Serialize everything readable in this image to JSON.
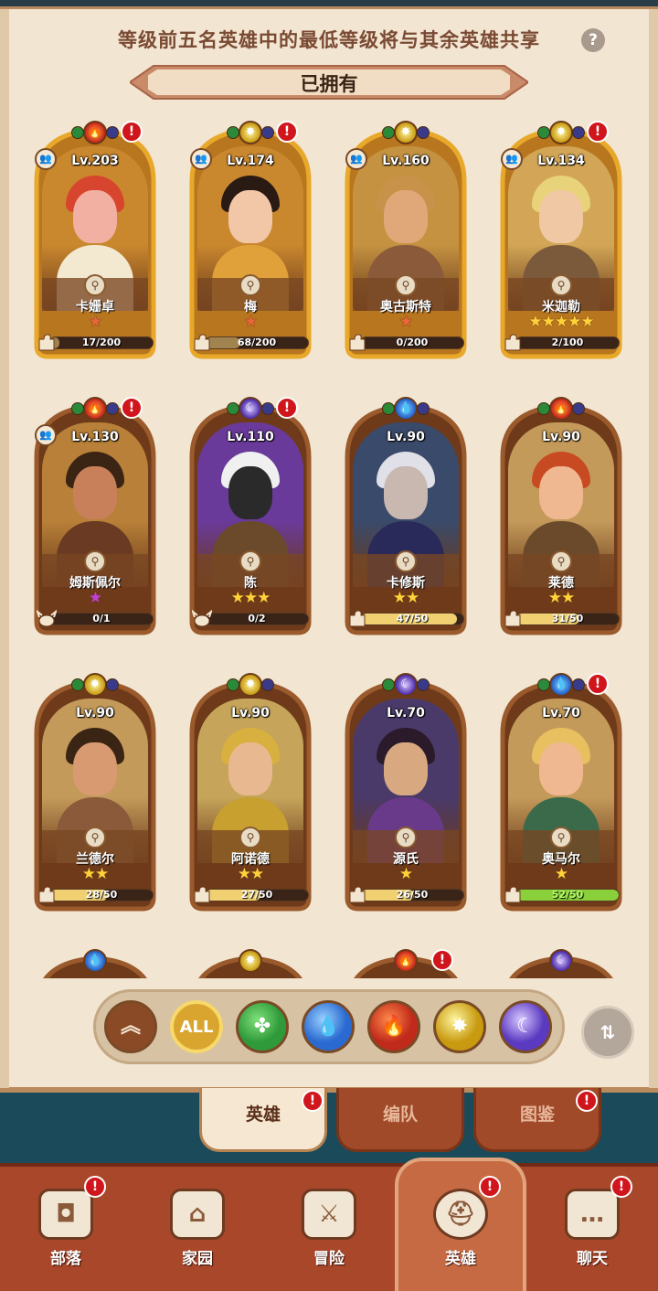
{
  "info_text": "等级前五名英雄中的最低等级将与其余英雄共享",
  "help_icon": "?",
  "section_title": "已拥有",
  "heroes": [
    {
      "level": "Lv.203",
      "name": "卡姗卓",
      "stars": "★",
      "star_color": "#e8663a",
      "progress_text": "17/200",
      "progress": 0.085,
      "fill_color": "#a1834f",
      "shard": "puzzle",
      "frame": "gold",
      "bg": "#c9872e",
      "hair": "#d8452e",
      "skin": "#f1b0a2",
      "outfit": "#f3e8d0",
      "elements": [
        "fire"
      ],
      "alert": true,
      "people": true
    },
    {
      "level": "Lv.174",
      "name": "梅",
      "stars": "★",
      "star_color": "#e8663a",
      "progress_text": "68/200",
      "progress": 0.34,
      "fill_color": "#a1834f",
      "shard": "puzzle",
      "frame": "gold",
      "bg": "#c9872e",
      "hair": "#2a1a14",
      "skin": "#f2c7a8",
      "outfit": "#e0a13a",
      "elements": [
        "light"
      ],
      "alert": true,
      "people": true
    },
    {
      "level": "Lv.160",
      "name": "奥古斯特",
      "stars": "★",
      "star_color": "#e8663a",
      "progress_text": "0/200",
      "progress": 0.0,
      "fill_color": "#a1834f",
      "shard": "puzzle",
      "frame": "gold",
      "bg": "#c49240",
      "hair": "#c8924a",
      "skin": "#e0a878",
      "outfit": "#8a5a3a",
      "elements": [
        "light"
      ],
      "alert": false,
      "people": true
    },
    {
      "level": "Lv.134",
      "name": "米迦勒",
      "stars": "★★★★★",
      "star_color": "#ffd23a",
      "progress_text": "2/100",
      "progress": 0.02,
      "fill_color": "#a1834f",
      "shard": "puzzle",
      "frame": "gold",
      "bg": "#d2a656",
      "hair": "#e8d27a",
      "skin": "#f0c8a4",
      "outfit": "#7a5a3a",
      "elements": [
        "light"
      ],
      "alert": true,
      "people": true
    },
    {
      "level": "Lv.130",
      "name": "姆斯佩尔",
      "stars": "★",
      "star_color": "#c040d8",
      "progress_text": "0/1",
      "progress": 0.0,
      "fill_color": "#a1834f",
      "shard": "helmet",
      "frame": "copper",
      "bg": "#b88038",
      "hair": "#3a2414",
      "skin": "#c8805a",
      "outfit": "#6a3a22",
      "elements": [
        "fire"
      ],
      "alert": true,
      "people": true
    },
    {
      "level": "Lv.110",
      "name": "陈",
      "stars": "★★★",
      "star_color": "#ffd23a",
      "progress_text": "0/2",
      "progress": 0.0,
      "fill_color": "#a1834f",
      "shard": "helmet",
      "frame": "copper",
      "bg": "#6a3a9a",
      "hair": "#f0f0f0",
      "skin": "#2a2a2a",
      "outfit": "#6a4a2a",
      "elements": [
        "moon"
      ],
      "alert": true,
      "people": false
    },
    {
      "level": "Lv.90",
      "name": "卡修斯",
      "stars": "★★",
      "star_color": "#ffd23a",
      "progress_text": "47/50",
      "progress": 0.94,
      "fill_color": "#f0d070",
      "shard": "puzzle",
      "frame": "copper",
      "bg": "#3a4a6a",
      "hair": "#e0e0e8",
      "skin": "#c8b8b0",
      "outfit": "#2a2a5a",
      "elements": [
        "water"
      ],
      "alert": false,
      "people": false
    },
    {
      "level": "Lv.90",
      "name": "莱德",
      "stars": "★★",
      "star_color": "#ffd23a",
      "progress_text": "31/50",
      "progress": 0.62,
      "fill_color": "#f0d070",
      "shard": "puzzle",
      "frame": "copper",
      "bg": "#c49a5a",
      "hair": "#c84a22",
      "skin": "#f0b890",
      "outfit": "#6a4a2a",
      "elements": [
        "fire"
      ],
      "alert": false,
      "people": false
    },
    {
      "level": "Lv.90",
      "name": "兰德尔",
      "stars": "★★",
      "star_color": "#ffd23a",
      "progress_text": "28/50",
      "progress": 0.56,
      "fill_color": "#f0d070",
      "shard": "puzzle",
      "frame": "copper",
      "bg": "#c49a5a",
      "hair": "#3a2414",
      "skin": "#d89a70",
      "outfit": "#8a5a3a",
      "elements": [
        "light"
      ],
      "alert": false,
      "people": false
    },
    {
      "level": "Lv.90",
      "name": "阿诺德",
      "stars": "★★",
      "star_color": "#ffd23a",
      "progress_text": "27/50",
      "progress": 0.54,
      "fill_color": "#f0d070",
      "shard": "puzzle",
      "frame": "copper",
      "bg": "#c6a55a",
      "hair": "#d8b040",
      "skin": "#e8b890",
      "outfit": "#c8a030",
      "elements": [
        "light"
      ],
      "alert": false,
      "people": false
    },
    {
      "level": "Lv.70",
      "name": "源氏",
      "stars": "★",
      "star_color": "#ffd23a",
      "progress_text": "26/50",
      "progress": 0.52,
      "fill_color": "#f0d070",
      "shard": "puzzle",
      "frame": "copper",
      "bg": "#4a3a6a",
      "hair": "#2a1a2a",
      "skin": "#d8a880",
      "outfit": "#6a3a8a",
      "elements": [
        "moon"
      ],
      "alert": false,
      "people": false
    },
    {
      "level": "Lv.70",
      "name": "奥马尔",
      "stars": "★",
      "star_color": "#ffd23a",
      "progress_text": "52/50",
      "progress": 1.0,
      "fill_color": "#8ad03a",
      "shard": "puzzle",
      "frame": "copper",
      "bg": "#c49a5a",
      "hair": "#e8c060",
      "skin": "#f0b890",
      "outfit": "#3a6a4a",
      "elements": [
        "water"
      ],
      "alert": true,
      "people": false,
      "progress_green": true
    }
  ],
  "partial_row": [
    {
      "elements": [
        "water"
      ],
      "alert": false
    },
    {
      "elements": [
        "light"
      ],
      "alert": false
    },
    {
      "elements": [
        "fire"
      ],
      "alert": true
    },
    {
      "elements": [
        "moon"
      ],
      "alert": false
    }
  ],
  "filters": [
    {
      "key": "up",
      "label": "︽",
      "bg": "#8a4a26",
      "color": "#f3e6d0"
    },
    {
      "key": "all",
      "label": "ALL",
      "bg": "#d9a52e",
      "color": "#fff"
    },
    {
      "key": "nature",
      "label": "✤",
      "bg": "#2f9a3a",
      "color": "#7fe07a"
    },
    {
      "key": "water",
      "label": "💧",
      "bg": "#2a6ad0",
      "color": "#9ad0ff"
    },
    {
      "key": "fire",
      "label": "🔥",
      "bg": "#c02a1a",
      "color": "#ff8a4a"
    },
    {
      "key": "light",
      "label": "✸",
      "bg": "#c89a10",
      "color": "#fff6a0"
    },
    {
      "key": "moon",
      "label": "☾",
      "bg": "#5a3ac0",
      "color": "#d8c8ff"
    }
  ],
  "sort_icon": "⇅",
  "subtabs": [
    {
      "label": "英雄",
      "active": true,
      "alert": true
    },
    {
      "label": "编队",
      "active": false,
      "alert": false
    },
    {
      "label": "图鉴",
      "active": false,
      "alert": true
    }
  ],
  "alert_mark": "!",
  "nav": [
    {
      "label": "部落",
      "icon": "shield-icon",
      "glyph": "◘",
      "alert": true
    },
    {
      "label": "家园",
      "icon": "home-icon",
      "glyph": "⌂",
      "alert": false
    },
    {
      "label": "冒险",
      "icon": "swords-icon",
      "glyph": "⚔",
      "alert": false
    },
    {
      "label": "英雄",
      "icon": "viking-helmet-icon",
      "glyph": "⛑",
      "alert": true,
      "active": true
    },
    {
      "label": "聊天",
      "icon": "chat-icon",
      "glyph": "…",
      "alert": true
    }
  ]
}
